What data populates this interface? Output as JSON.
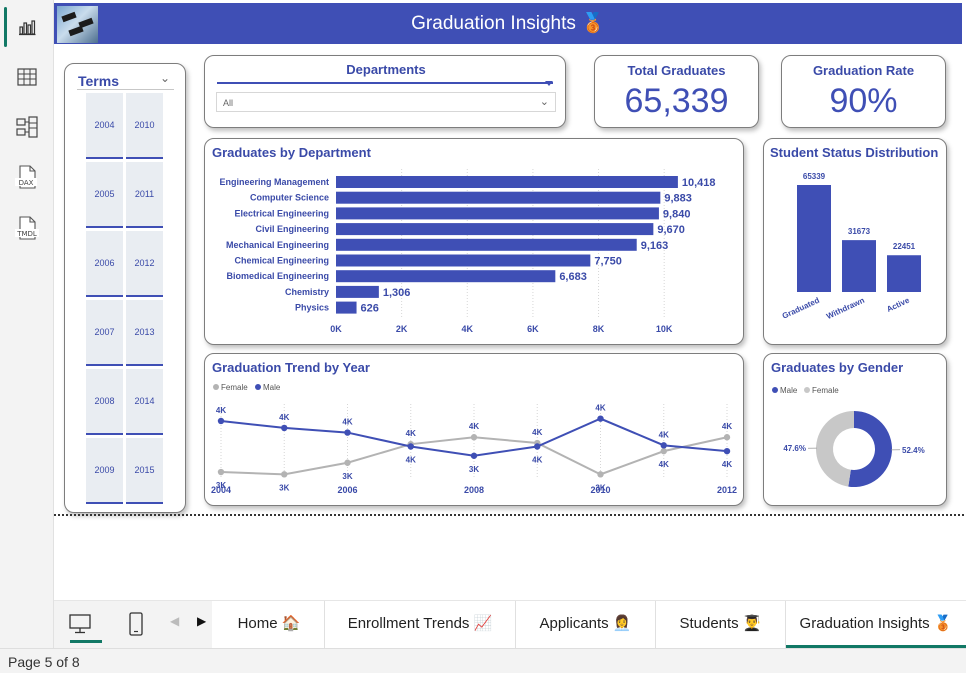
{
  "rail": {
    "items": [
      {
        "name": "report-view-icon"
      },
      {
        "name": "table-view-icon"
      },
      {
        "name": "model-view-icon"
      },
      {
        "label": "DAX"
      },
      {
        "label": "TMDL"
      }
    ]
  },
  "banner": {
    "title": "Graduation Insights 🥉"
  },
  "terms": {
    "title": "Terms",
    "years": [
      "2004",
      "2010",
      "2005",
      "2011",
      "2006",
      "2012",
      "2007",
      "2013",
      "2008",
      "2014",
      "2009",
      "2015"
    ]
  },
  "departments": {
    "title": "Departments",
    "selected": "All"
  },
  "kpis": {
    "total_graduates": {
      "title": "Total Graduates",
      "value": "65,339"
    },
    "graduation_rate": {
      "title": "Graduation Rate",
      "value": "90%"
    }
  },
  "bydept": {
    "title": "Graduates by Department"
  },
  "status": {
    "title": "Student Status Distribution"
  },
  "trend": {
    "title": "Graduation Trend by Year"
  },
  "gender": {
    "title": "Graduates by Gender"
  },
  "chart_data": [
    {
      "type": "bar",
      "orientation": "horizontal",
      "title": "Graduates by Department",
      "categories": [
        "Engineering Management",
        "Computer Science",
        "Electrical Engineering",
        "Civil Engineering",
        "Mechanical Engineering",
        "Chemical Engineering",
        "Biomedical Engineering",
        "Chemistry",
        "Physics"
      ],
      "values": [
        10418,
        9883,
        9840,
        9670,
        9163,
        7750,
        6683,
        1306,
        626
      ],
      "data_labels": [
        "10,418",
        "9,883",
        "9,840",
        "9,670",
        "9,163",
        "7,750",
        "6,683",
        "1,306",
        "626"
      ],
      "xticks": [
        "0K",
        "2K",
        "4K",
        "6K",
        "8K",
        "10K"
      ],
      "xlim": [
        0,
        11000
      ],
      "color": "#3f4fb5"
    },
    {
      "type": "bar",
      "title": "Student Status Distribution",
      "categories": [
        "Graduated",
        "Withdrawn",
        "Active"
      ],
      "values": [
        65339,
        31673,
        22451
      ],
      "data_labels": [
        "65339",
        "31673",
        "22451"
      ],
      "color": "#3f4fb5"
    },
    {
      "type": "line",
      "title": "Graduation Trend by Year",
      "x": [
        2004,
        2005,
        2006,
        2007,
        2008,
        2009,
        2010,
        2011,
        2012
      ],
      "xticks": [
        "2004",
        "2006",
        "2008",
        "2010",
        "2012"
      ],
      "legend": "top-left",
      "series": [
        {
          "name": "Female",
          "color": "#b3b3b3",
          "values": [
            2700,
            2600,
            3100,
            3900,
            4200,
            3950,
            2600,
            3600,
            4200
          ],
          "labels": [
            "3K",
            "3K",
            "3K",
            "4K",
            "4K",
            "4K",
            "3K",
            "4K",
            "4K"
          ]
        },
        {
          "name": "Male",
          "color": "#3f4fb5",
          "values": [
            4900,
            4600,
            4400,
            3800,
            3400,
            3800,
            5000,
            3850,
            3600
          ],
          "labels": [
            "4K",
            "4K",
            "4K",
            "4K",
            "3K",
            "4K",
            "4K",
            "4K",
            "4K"
          ]
        }
      ]
    },
    {
      "type": "pie",
      "donut": true,
      "title": "Graduates by Gender",
      "legend": "top-left",
      "slices": [
        {
          "name": "Male",
          "value": 52.4,
          "label": "52.4%",
          "color": "#3f4fb5"
        },
        {
          "name": "Female",
          "value": 47.6,
          "label": "47.6%",
          "color": "#c8c8c8"
        }
      ]
    }
  ],
  "tabs": {
    "items": [
      {
        "label": "Home 🏠"
      },
      {
        "label": "Enrollment Trends 📈"
      },
      {
        "label": "Applicants 👩‍💼"
      },
      {
        "label": "Students 👨‍🎓"
      },
      {
        "label": "Graduation Insights 🥉"
      }
    ],
    "active_index": 4
  },
  "status_bar": {
    "page": "Page 5 of 8"
  }
}
